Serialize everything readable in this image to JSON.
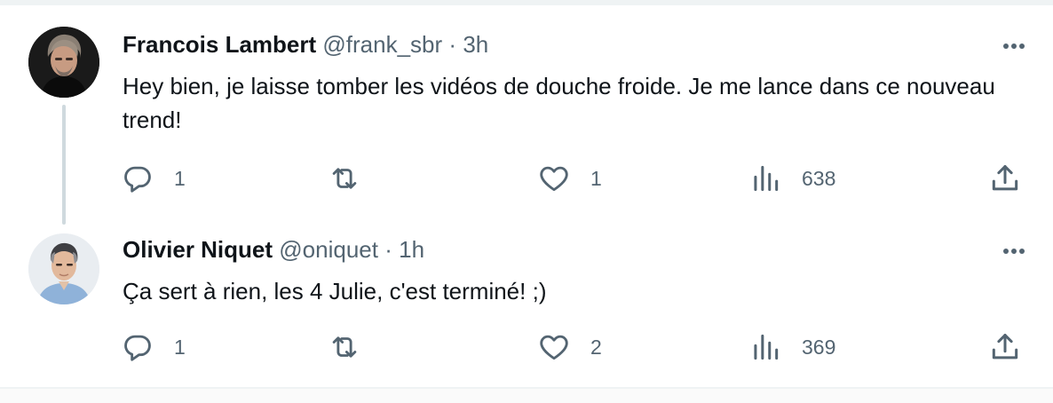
{
  "tweets": [
    {
      "display_name": "Francois Lambert",
      "handle": "@frank_sbr",
      "separator": "·",
      "time": "3h",
      "text": "Hey bien, je laisse tomber les vidéos de douche froide. Je me lance dans ce nouveau trend!",
      "replies": "1",
      "retweets": "",
      "likes": "1",
      "views": "638"
    },
    {
      "display_name": "Olivier Niquet",
      "handle": "@oniquet",
      "separator": "·",
      "time": "1h",
      "text": "Ça sert à rien, les 4 Julie, c'est terminé! ;)",
      "replies": "1",
      "retweets": "",
      "likes": "2",
      "views": "369"
    }
  ],
  "icons": {
    "reply": "reply-icon",
    "retweet": "retweet-icon",
    "like": "heart-icon",
    "views": "views-icon",
    "share": "share-icon",
    "more": "more-icon"
  },
  "colors": {
    "text": "#0f1419",
    "muted": "#536471",
    "thread_line": "#cfd9de"
  }
}
